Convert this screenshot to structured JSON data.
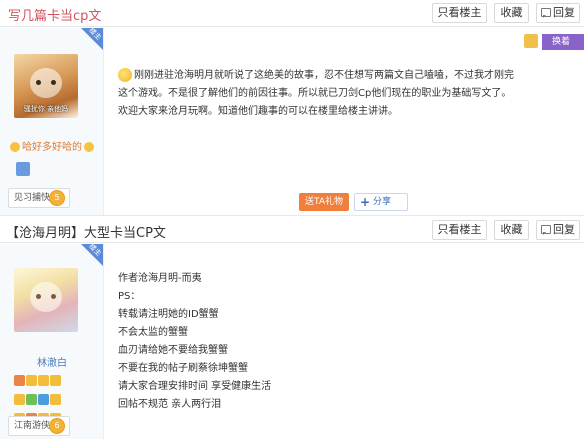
{
  "thread": {
    "title": "写几篇卡当cp文",
    "buttons": {
      "only_op": "只看楼主",
      "favorite": "收藏",
      "reply": "回复"
    }
  },
  "post1": {
    "ribbon": "楼主",
    "avatar_caption": "骚扰你 亲他妈",
    "username": "哈好多好哈的",
    "rank": "见习捕快",
    "rank_level": "5",
    "top_right_tag": "换着",
    "content_lines": [
      "刚刚进驻沧海明月就听说了这绝美的故事，忍不住想写两篇文自己嗑嗑，不过我才刚完",
      "这个游戏。不是很了解他们的前因往事。所以就已刀剑Cp他们现在的职业为基础写文了。",
      "欢迎大家来沧月玩啊。知道他们趣事的可以在楼里给楼主讲讲。"
    ],
    "gift_label": "送TA礼物",
    "share_label": "分享"
  },
  "post2_header": {
    "title": "【沧海月明】大型卡当CP文",
    "buttons": {
      "only_op": "只看楼主",
      "favorite": "收藏",
      "reply": "回复"
    }
  },
  "post2": {
    "ribbon": "楼主",
    "username": "林澈白",
    "rank": "江南游侠",
    "rank_level": "6",
    "content_lines": [
      "作者沧海月明-而夷",
      "PS：",
      "转载请注明她的ID蟹蟹",
      "不会太监的蟹蟹",
      "血刃请给她不要给我蟹蟹",
      "不要在我的帖子刷蔡徐坤蟹蟹",
      "请大家合理安排时间 享受健康生活",
      "回帖不规范 亲人两行泪"
    ]
  },
  "colors": {
    "title_red": "#d0545e",
    "gift_orange": "#f07f3c",
    "share_blue": "#3a6db3",
    "ribbon_blue": "#5b8bd6"
  }
}
